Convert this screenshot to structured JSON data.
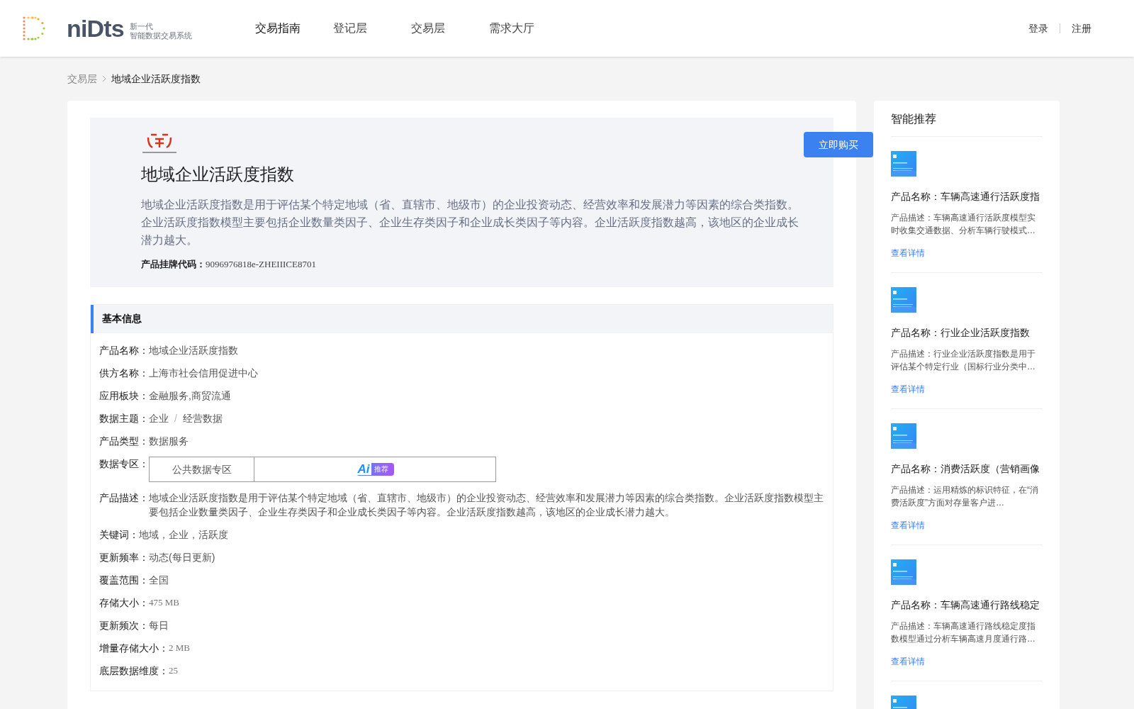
{
  "header": {
    "logo_text": "niDts",
    "logo_subtitle_1": "新一代",
    "logo_subtitle_2": "智能数据交易系统",
    "nav": [
      {
        "label": "交易指南",
        "selected": true
      },
      {
        "label": "登记层",
        "selected": false
      },
      {
        "label": "交易层",
        "selected": false
      },
      {
        "label": "需求大厅",
        "selected": false
      }
    ],
    "login": "登录",
    "register": "注册"
  },
  "breadcrumb": [
    "交易层",
    "地域企业活跃度指数"
  ],
  "product": {
    "title": "地域企业活跃度指数",
    "description": "地域企业活跃度指数是用于评估某个特定地域（省、直辖市、地级市）的企业投资动态、经营效率和发展潜力等因素的综合类指数。企业活跃度指数模型主要包括企业数量类因子、企业生存类因子和企业成长类因子等内容。企业活跃度指数越高，该地区的企业成长潜力越大。",
    "code_label": "产品挂牌代码：",
    "code": "9096976818e-ZHEIIICE8701",
    "buy_button": "立即购买"
  },
  "basic_info": {
    "heading": "基本信息",
    "rows": [
      {
        "kind": "text",
        "label": "产品名称：",
        "value": "地域企业活跃度指数"
      },
      {
        "kind": "text",
        "label": "供方名称：",
        "value": "上海市社会信用促进中心"
      },
      {
        "kind": "text",
        "label": "应用板块：",
        "value": "金融服务,商贸流通"
      },
      {
        "kind": "path",
        "label": "数据主题：",
        "parts": [
          "企业",
          "经营数据"
        ],
        "separator": "/"
      },
      {
        "kind": "text",
        "label": "产品类型：",
        "value": "数据服务"
      },
      {
        "kind": "zone",
        "label": "数据专区：",
        "value": "公共数据专区",
        "badge_ai": "Ai",
        "badge_text": "推荐"
      },
      {
        "kind": "text",
        "label": "产品描述：",
        "value": "地域企业活跃度指数是用于评估某个特定地域（省、直辖市、地级市）的企业投资动态、经营效率和发展潜力等因素的综合类指数。企业活跃度指数模型主要包括企业数量类因子、企业生存类因子和企业成长类因子等内容。企业活跃度指数越高，该地区的企业成长潜力越大。"
      },
      {
        "kind": "text",
        "label": "关键词：",
        "value": "地域，企业，活跃度"
      },
      {
        "kind": "text",
        "label": "更新频率：",
        "value": "动态(每日更新)"
      },
      {
        "kind": "text",
        "label": "覆盖范围：",
        "value": "全国"
      },
      {
        "kind": "mono",
        "label": "存储大小：",
        "value": "475 MB"
      },
      {
        "kind": "text",
        "label": "更新频次：",
        "value": "每日"
      },
      {
        "kind": "mono",
        "label": "增量存储大小：",
        "value": "2 MB"
      },
      {
        "kind": "mono",
        "label": "底层数据维度：",
        "value": "25"
      }
    ]
  },
  "recommend": {
    "heading": "智能推荐",
    "items": [
      {
        "kind": "product",
        "name": "产品名称：车辆高速通行活跃度指",
        "description": "产品描述：车辆高速通行活跃度模型实时收集交通数据、分析车辆行驶模式…",
        "link": "查看详情"
      },
      {
        "kind": "product",
        "name": "产品名称：行业企业活跃度指数",
        "description": "产品描述：行业企业活跃度指数是用于评估某个特定行业（国标行业分类中…",
        "link": "查看详情"
      },
      {
        "kind": "product",
        "name": "产品名称：消费活跃度（营销画像",
        "description": "产品描述：运用精炼的标识特征，在“消费活跃度”方面对存量客户进…",
        "link": "查看详情"
      },
      {
        "kind": "product",
        "name": "产品名称：车辆高速通行路线稳定",
        "description": "产品描述：车辆高速通行路线稳定度指数模型通过分析车辆高速月度通行路…",
        "link": "查看详情"
      },
      {
        "kind": "picture_only"
      }
    ]
  }
}
